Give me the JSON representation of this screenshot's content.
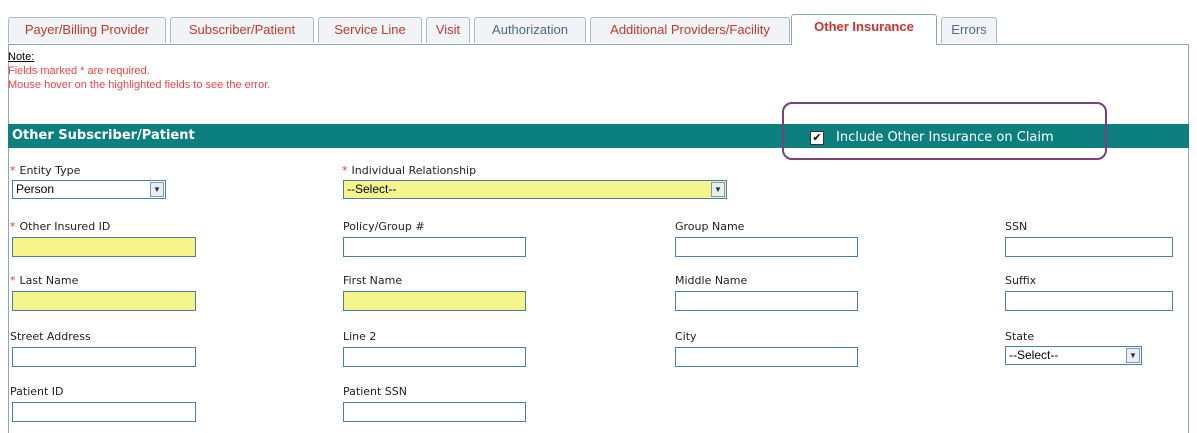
{
  "tabs": [
    {
      "label": "Payer/Billing Provider"
    },
    {
      "label": "Subscriber/Patient"
    },
    {
      "label": "Service Line"
    },
    {
      "label": "Visit"
    },
    {
      "label": "Authorization"
    },
    {
      "label": "Additional Providers/Facility"
    },
    {
      "label": "Other Insurance"
    },
    {
      "label": "Errors"
    }
  ],
  "active_tab": "Other Insurance",
  "note": {
    "label": "Note:",
    "line1": "Fields marked * are required.",
    "line2": "Mouse hover on the highlighted fields to see the error."
  },
  "section": {
    "title": "Other Subscriber/Patient",
    "include_label": "Include Other Insurance on Claim",
    "include_checked": true,
    "include_check_glyph": "✔"
  },
  "fields": {
    "entity_type": {
      "label": "Entity Type",
      "required": true,
      "value": "Person"
    },
    "individual_relationship": {
      "label": "Individual Relationship",
      "required": true,
      "value": "--Select--"
    },
    "other_insured_id": {
      "label": "Other Insured ID",
      "required": true,
      "value": ""
    },
    "policy_group": {
      "label": "Policy/Group #",
      "value": ""
    },
    "group_name": {
      "label": "Group Name",
      "value": ""
    },
    "ssn": {
      "label": "SSN",
      "value": ""
    },
    "last_name": {
      "label": "Last Name",
      "required": true,
      "value": ""
    },
    "first_name": {
      "label": "First Name",
      "value": ""
    },
    "middle_name": {
      "label": "Middle Name",
      "value": ""
    },
    "suffix": {
      "label": "Suffix",
      "value": ""
    },
    "street_address": {
      "label": "Street Address",
      "value": ""
    },
    "line2": {
      "label": "Line 2",
      "value": ""
    },
    "city": {
      "label": "City",
      "value": ""
    },
    "state": {
      "label": "State",
      "value": "--Select--"
    },
    "patient_id": {
      "label": "Patient ID",
      "value": ""
    },
    "patient_ssn": {
      "label": "Patient SSN",
      "value": ""
    }
  },
  "required_marker": "*",
  "dropdown_arrow": "▼",
  "colors": {
    "section_header": "#0e7f7f",
    "required_highlight": "#f5f58c",
    "active_tab_text": "#d32f2f",
    "annotation_outline": "#7b3f7b"
  }
}
